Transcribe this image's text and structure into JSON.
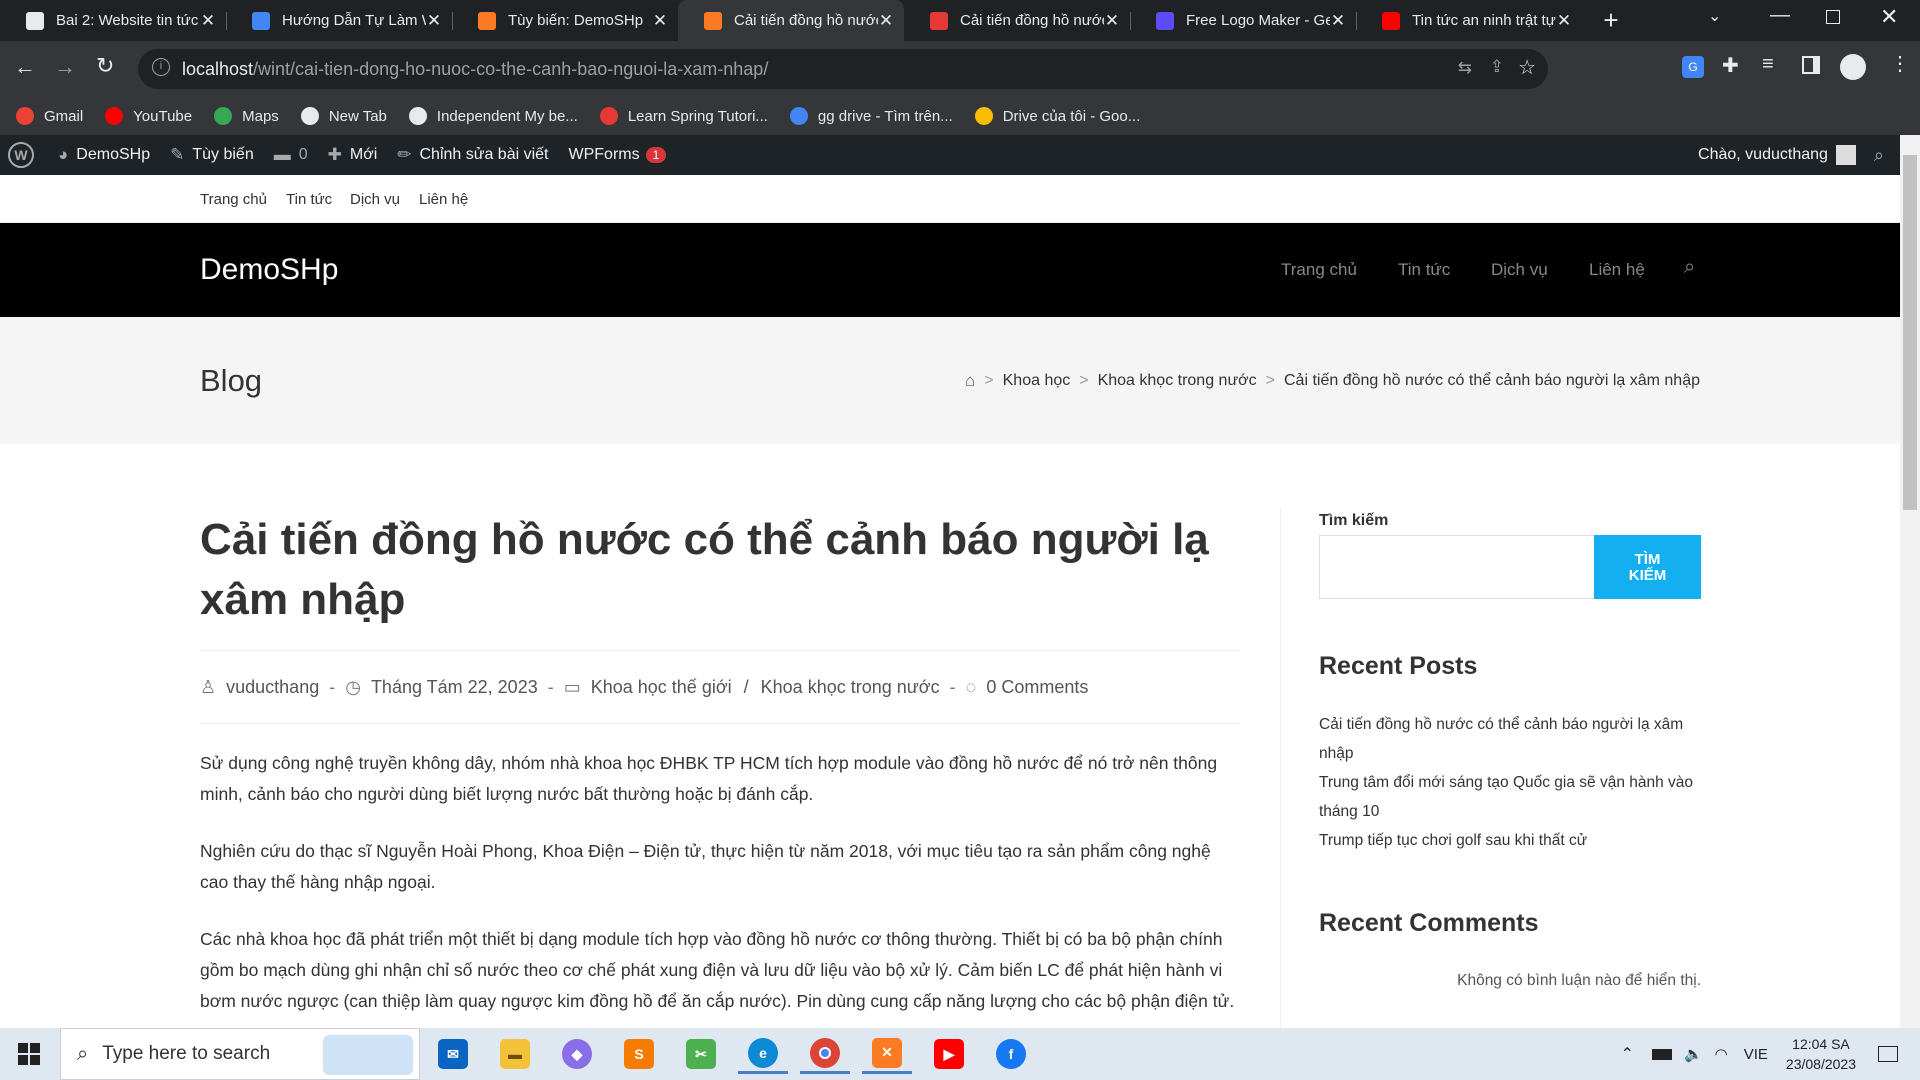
{
  "browser": {
    "tabs": [
      {
        "title": "Bai 2: Website tin tức",
        "icon": "page-icon",
        "color": "#e8eaed"
      },
      {
        "title": "Hướng Dẫn Tự Làm W",
        "icon": "image-icon",
        "color": "#4285f4"
      },
      {
        "title": "Tùy biến: DemoSHp",
        "icon": "xampp-icon",
        "color": "#fb7a24"
      },
      {
        "title": "Cải tiến đồng hồ nước",
        "icon": "xampp-icon",
        "color": "#fb7a24"
      },
      {
        "title": "Cải tiến đồng hồ nước",
        "icon": "doc-icon",
        "color": "#e53935"
      },
      {
        "title": "Free Logo Maker - Ge",
        "icon": "logo-maker-icon",
        "color": "#5b4cf5"
      },
      {
        "title": "Tin tức an ninh trật tự",
        "icon": "youtube-icon",
        "color": "#ff0000"
      }
    ],
    "active_tab": 3,
    "url_host": "localhost",
    "url_path": "/wint/cai-tien-dong-ho-nuoc-co-the-canh-bao-nguoi-la-xam-nhap/",
    "bookmarks": [
      {
        "label": "Gmail",
        "icon": "gmail-icon",
        "color": "#ea4335"
      },
      {
        "label": "YouTube",
        "icon": "youtube-icon",
        "color": "#ff0000"
      },
      {
        "label": "Maps",
        "icon": "maps-pin-icon",
        "color": "#34a853"
      },
      {
        "label": "New Tab",
        "icon": "globe-icon",
        "color": "#e8eaed"
      },
      {
        "label": "Independent My be...",
        "icon": "globe-icon",
        "color": "#e8eaed"
      },
      {
        "label": "Learn Spring Tutori...",
        "icon": "spring-icon",
        "color": "#e53935"
      },
      {
        "label": "gg drive - Tìm trên...",
        "icon": "google-icon",
        "color": "#4285f4"
      },
      {
        "label": "Drive của tôi - Goo...",
        "icon": "drive-icon",
        "color": "#fbbc04"
      }
    ]
  },
  "adminbar": {
    "site": "DemoSHp",
    "customize": "Tùy biến",
    "comments": "0",
    "new": "Mới",
    "edit_post": "Chỉnh sửa bài viết",
    "wpforms": "WPForms",
    "wpforms_count": "1",
    "greeting": "Chào, vuducthang"
  },
  "topnav": [
    "Trang chủ",
    "Tin tức",
    "Dịch vụ",
    "Liên hệ"
  ],
  "header": {
    "logo": "DemoSHp",
    "menu": [
      "Trang chủ",
      "Tin tức",
      "Dịch vụ",
      "Liên hệ"
    ]
  },
  "pagebar": {
    "title": "Blog",
    "breadcrumbs": [
      "Khoa học",
      "Khoa khọc trong nước",
      "Cải tiến đồng hồ nước có thể cảnh báo người lạ xâm nhập"
    ]
  },
  "post": {
    "title": "Cải tiến đồng hồ nước có thể cảnh báo người lạ xâm nhập",
    "author": "vuducthang",
    "date": "Tháng Tám 22, 2023",
    "cat1": "Khoa học thế giới",
    "cat_sep": "/",
    "cat2": "Khoa khọc trong nước",
    "comments": "0 Comments",
    "paragraphs": [
      "Sử dụng công nghệ truyền không dây, nhóm nhà khoa học ĐHBK TP HCM tích hợp module vào đồng hồ nước để nó trở nên thông minh, cảnh báo cho người dùng biết lượng nước bất thường hoặc bị đánh cắp.",
      "Nghiên cứu do thạc sĩ Nguyễn Hoài Phong, Khoa Điện – Điện tử, thực hiện từ năm 2018, với mục tiêu tạo ra sản phẩm công nghệ cao thay thế hàng nhập ngoại.",
      "Các nhà khoa học đã phát triển một thiết bị dạng module tích hợp vào đồng hồ nước cơ thông thường. Thiết bị có ba bộ phận chính gồm bo mạch dùng ghi nhận chỉ số nước theo cơ chế phát xung điện và lưu dữ liệu vào bộ xử lý. Cảm biến LC để phát hiện hành vi bơm nước ngược (can thiệp làm quay ngược kim đồng hồ để ăn cắp nước). Pin dùng cung cấp năng lượng cho các bộ phận điện tử."
    ]
  },
  "sidebar": {
    "search_label": "Tìm kiếm",
    "search_button": "TÌM KIẾM",
    "recent_posts_title": "Recent Posts",
    "recent_posts": [
      "Cải tiến đồng hồ nước có thể cảnh báo người lạ xâm nhập",
      "Trung tâm đổi mới sáng tạo Quốc gia sẽ vận hành vào tháng 10",
      "Trump tiếp tục chơi golf sau khi thất cử"
    ],
    "recent_comments_title": "Recent Comments",
    "no_comments": "Không có bình luận nào để hiển thị."
  },
  "taskbar": {
    "search_placeholder": "Type here to search",
    "language": "VIE",
    "time": "12:04 SA",
    "date": "23/08/2023"
  },
  "colors": {
    "accent": "#13aff0",
    "admin_bg": "#1d2327",
    "chrome_bg": "#202124"
  }
}
